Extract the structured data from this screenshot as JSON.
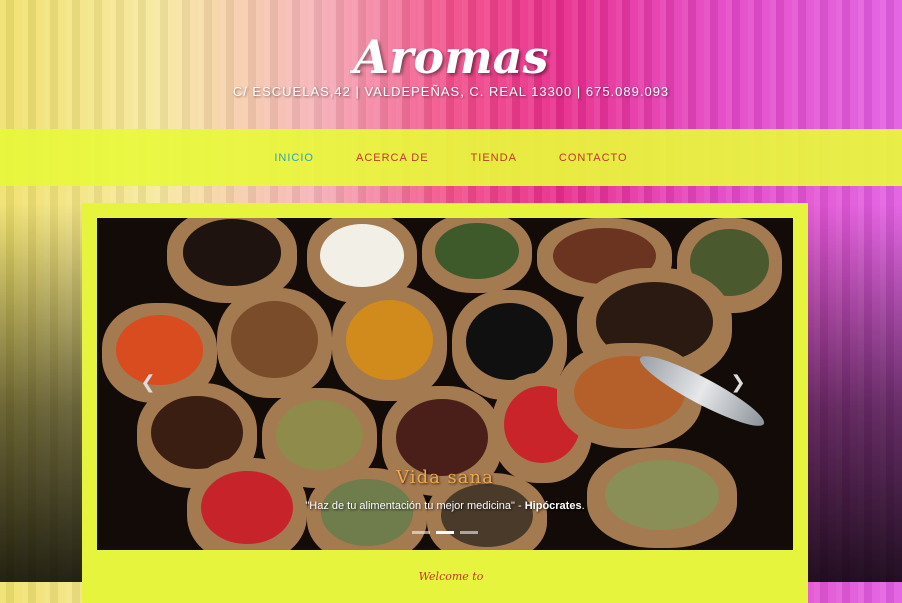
{
  "header": {
    "brand": "Aromas",
    "address": "C/ ESCUELAS,42 | VALDEPEÑAS, C. REAL 13300 | 675.089.093"
  },
  "nav": {
    "items": [
      {
        "label": "INICIO",
        "active": true
      },
      {
        "label": "ACERCA DE",
        "active": false
      },
      {
        "label": "TIENDA",
        "active": false
      },
      {
        "label": "CONTACTO",
        "active": false
      }
    ]
  },
  "slider": {
    "caption_title": "Vida sana",
    "caption_quote": "\"Haz de tu alimentación tu mejor medicina\" - ",
    "caption_author": "Hipócrates",
    "caption_end": ".",
    "prev_icon": "chevron-left-icon",
    "next_icon": "chevron-right-icon",
    "slide_count": 3,
    "active_slide": 2
  },
  "welcome": "Welcome to",
  "colors": {
    "nav_bg": "#e8f83c",
    "nav_text": "#c0392b",
    "nav_active": "#2ba4b7",
    "panel_bg": "#e6f43e"
  }
}
